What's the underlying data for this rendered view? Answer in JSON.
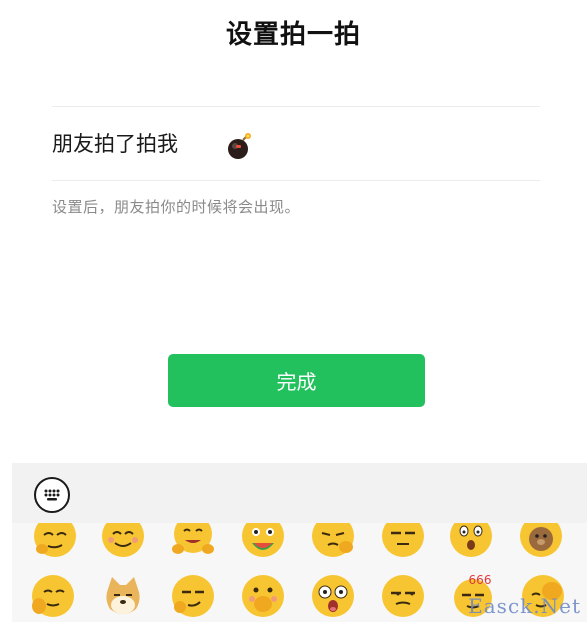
{
  "header": {
    "title": "设置拍一拍"
  },
  "setting": {
    "label": "朋友拍了拍我",
    "emoji_icon": "bomb-icon",
    "hint": "设置后，朋友拍你的时候将会出现。"
  },
  "actions": {
    "done_label": "完成"
  },
  "colors": {
    "accent": "#22c15e",
    "panel": "#f3f3f3"
  },
  "emoji_panel": {
    "keyboard_icon": "keyboard-icon",
    "row1": [
      "thinking-face-icon",
      "smiling-face-icon",
      "hugging-face-icon",
      "grinning-watermelon-face-icon",
      "facepalm-face-icon",
      "expressionless-face-icon",
      "surprised-face-icon",
      "bear-face-icon"
    ],
    "row2": [
      "salute-face-icon",
      "doge-icon",
      "smirk-face-icon",
      "hand-over-mouth-face-icon",
      "star-struck-face-icon",
      "unamused-face-icon",
      "666-face-icon",
      "cover-face-icon"
    ],
    "badge_666": "666"
  },
  "watermark": "Easck.Net"
}
